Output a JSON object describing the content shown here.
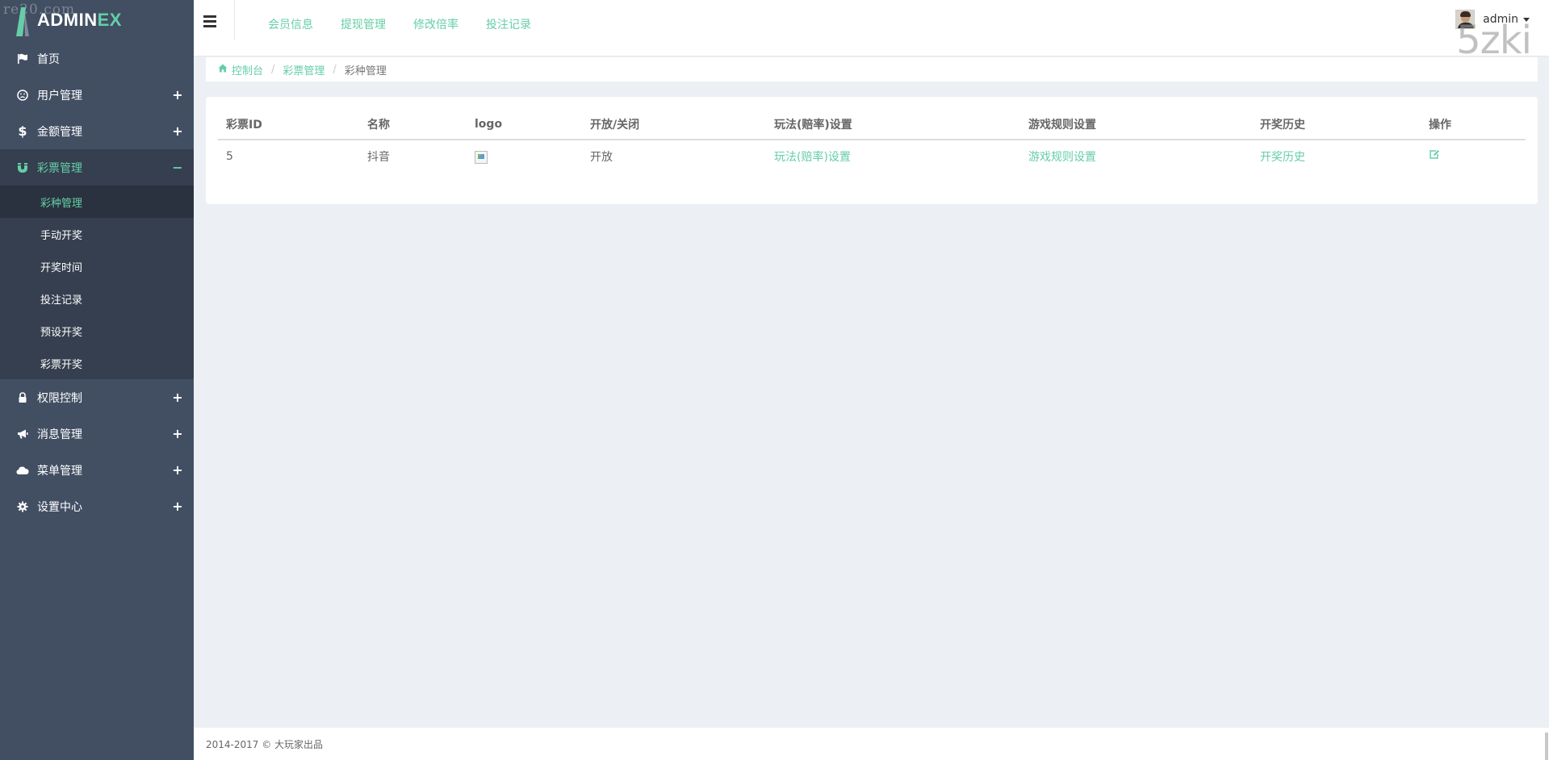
{
  "watermark_left": "re​20.com",
  "watermark_right": "5zki",
  "logo": {
    "main": "ADMIN",
    "accent": "EX"
  },
  "sidebar": {
    "items": [
      {
        "label": "首页",
        "icon": "flag-icon",
        "expandable": false
      },
      {
        "label": "用户管理",
        "icon": "smile-icon",
        "expandable": true,
        "toggle": "+"
      },
      {
        "label": "金额管理",
        "icon": "dollar-icon",
        "expandable": true,
        "toggle": "+"
      },
      {
        "label": "彩票管理",
        "icon": "magnet-icon",
        "expandable": true,
        "toggle": "−",
        "active": true,
        "children": [
          "彩种管理",
          "手动开奖",
          "开奖时间",
          "投注记录",
          "预设开奖",
          "彩票开奖"
        ]
      },
      {
        "label": "权限控制",
        "icon": "lock-icon",
        "expandable": true,
        "toggle": "+"
      },
      {
        "label": "消息管理",
        "icon": "bullhorn-icon",
        "expandable": true,
        "toggle": "+"
      },
      {
        "label": "菜单管理",
        "icon": "cloud-icon",
        "expandable": true,
        "toggle": "+"
      },
      {
        "label": "设置中心",
        "icon": "gear-icon",
        "expandable": true,
        "toggle": "+"
      }
    ]
  },
  "header": {
    "links": [
      "会员信息",
      "提现管理",
      "修改倍率",
      "投注记录"
    ],
    "user": "admin"
  },
  "breadcrumb": {
    "home": "控制台",
    "section": "彩票管理",
    "current": "彩种管理"
  },
  "table": {
    "columns": [
      "彩票ID",
      "名称",
      "logo",
      "开放/关闭",
      "玩法(赔率)设置",
      "游戏规则设置",
      "开奖历史",
      "操作"
    ],
    "rows": [
      {
        "id": "5",
        "name": "抖音",
        "status": "开放",
        "odds_link": "玩法(赔率)设置",
        "rules_link": "游戏规则设置",
        "history_link": "开奖历史"
      }
    ]
  },
  "footer": {
    "text": "2014-2017 © 大玩家出品"
  },
  "colors": {
    "accent": "#65cea7",
    "sidebar": "#424f63",
    "sidebar_dark": "#353f4f",
    "background": "#eceff3"
  }
}
